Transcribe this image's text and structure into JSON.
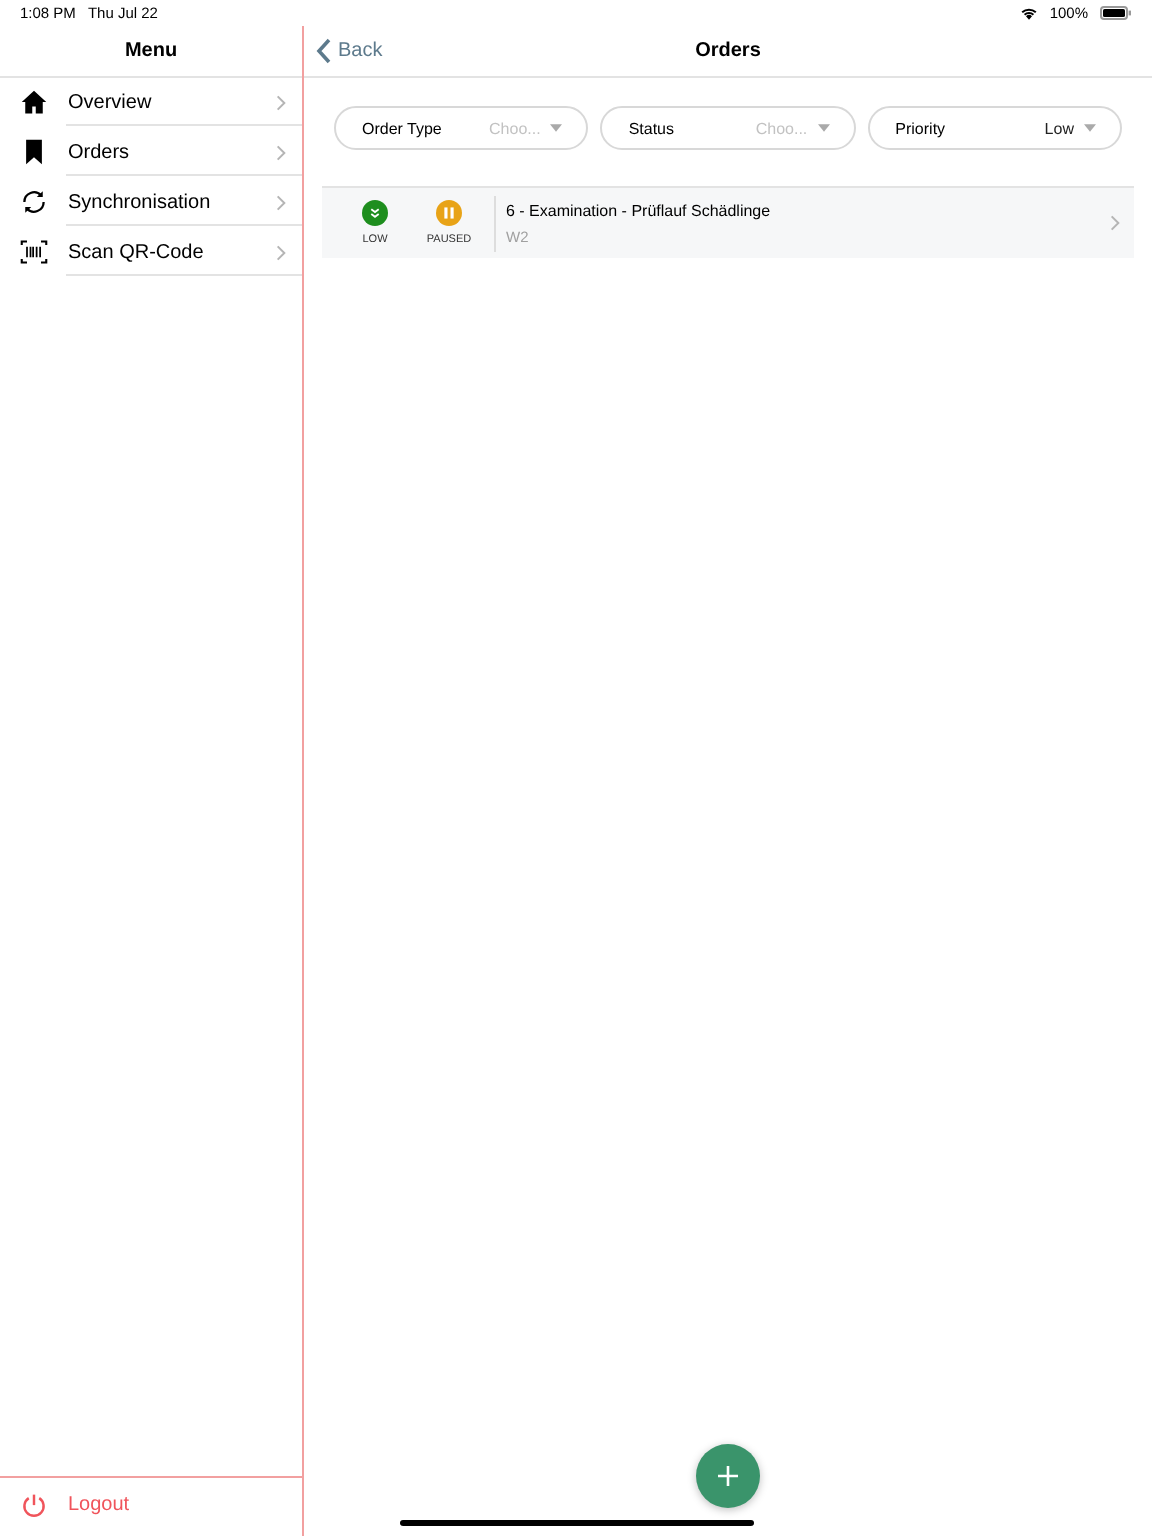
{
  "status_bar": {
    "time": "1:08 PM",
    "date": "Thu Jul 22",
    "battery": "100%"
  },
  "sidebar": {
    "title": "Menu",
    "items": [
      {
        "label": "Overview",
        "kind": "home"
      },
      {
        "label": "Orders",
        "kind": "bookmark"
      },
      {
        "label": "Synchronisation",
        "kind": "sync"
      },
      {
        "label": "Scan QR-Code",
        "kind": "qr"
      }
    ],
    "logout": "Logout"
  },
  "nav": {
    "back": "Back",
    "title": "Orders"
  },
  "filters": [
    {
      "label": "Order Type",
      "placeholder": "Choo..."
    },
    {
      "label": "Status",
      "placeholder": "Choo..."
    },
    {
      "label": "Priority",
      "value": "Low"
    }
  ],
  "orders": [
    {
      "badges": [
        {
          "kind": "priority",
          "label": "LOW",
          "color": "#1e8e1e"
        },
        {
          "kind": "paused",
          "label": "PAUSED",
          "color": "#e8a317"
        }
      ],
      "title": "6 - Examination - Prüflauf Schädlinge",
      "subtitle": "W2"
    }
  ]
}
